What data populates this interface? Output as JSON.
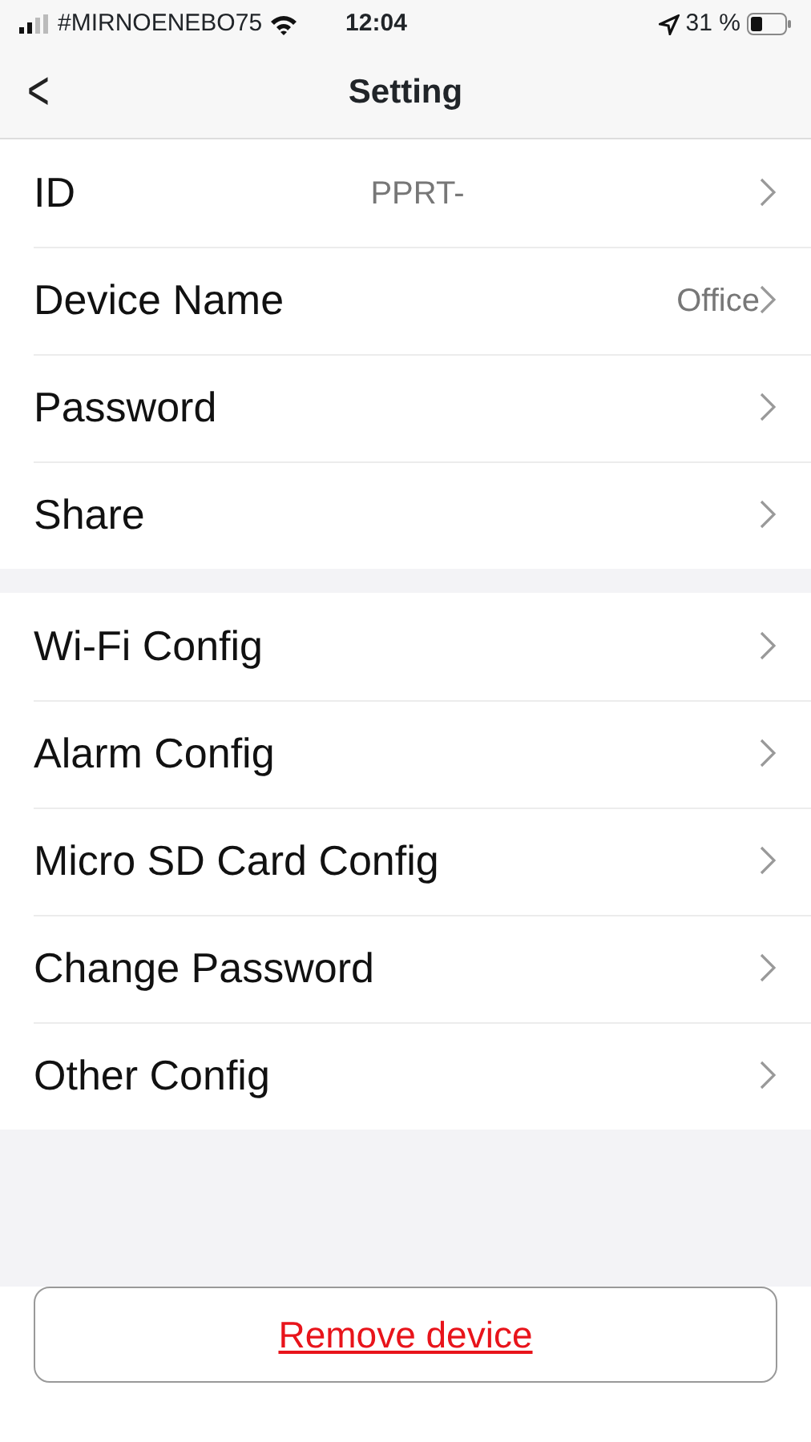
{
  "status_bar": {
    "carrier": "#MIRNOENEBO75",
    "time": "12:04",
    "battery": "31 %"
  },
  "nav": {
    "back": "<",
    "title": "Setting"
  },
  "groups": [
    {
      "rows": [
        {
          "label": "ID",
          "value": "PPRT-",
          "kind": "centered"
        },
        {
          "label": "Device Name",
          "value": "Office",
          "kind": "right"
        },
        {
          "label": "Password"
        },
        {
          "label": "Share"
        }
      ]
    },
    {
      "rows": [
        {
          "label": "Wi-Fi Config"
        },
        {
          "label": "Alarm Config"
        },
        {
          "label": "Micro SD Card Config"
        },
        {
          "label": "Change Password"
        },
        {
          "label": "Other Config"
        }
      ]
    }
  ],
  "remove_button": "Remove device"
}
